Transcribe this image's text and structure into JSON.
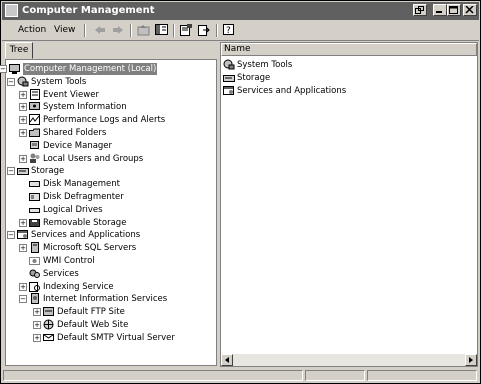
{
  "window": {
    "title": "Computer Management",
    "minimize_icon": "minimize-icon",
    "maximize_icon": "maximize-icon",
    "close_icon": "close-icon",
    "restore_icon": "restore-icon"
  },
  "menu": {
    "action": "Action",
    "view": "View"
  },
  "toolbar": {
    "buttons": [
      "back-icon",
      "forward-icon",
      "up-level-icon",
      "show-hide-tree-icon",
      "properties-icon",
      "export-list-icon",
      "help-icon"
    ]
  },
  "left_pane": {
    "tab_label": "Tree",
    "tree": [
      {
        "label": "Computer Management (Local)",
        "level": 0,
        "icon": "computer-management-icon",
        "expander": "minus",
        "selected": true
      },
      {
        "label": "System Tools",
        "level": 1,
        "icon": "system-tools-icon",
        "expander": "minus"
      },
      {
        "label": "Event Viewer",
        "level": 2,
        "icon": "event-viewer-icon",
        "expander": "plus"
      },
      {
        "label": "System Information",
        "level": 2,
        "icon": "system-information-icon",
        "expander": "plus"
      },
      {
        "label": "Performance Logs and Alerts",
        "level": 2,
        "icon": "performance-logs-icon",
        "expander": "plus"
      },
      {
        "label": "Shared Folders",
        "level": 2,
        "icon": "shared-folders-icon",
        "expander": "plus"
      },
      {
        "label": "Device Manager",
        "level": 2,
        "icon": "device-manager-icon",
        "expander": "none"
      },
      {
        "label": "Local Users and Groups",
        "level": 2,
        "icon": "local-users-icon",
        "expander": "plus"
      },
      {
        "label": "Storage",
        "level": 1,
        "icon": "storage-icon",
        "expander": "minus"
      },
      {
        "label": "Disk Management",
        "level": 2,
        "icon": "disk-management-icon",
        "expander": "none"
      },
      {
        "label": "Disk Defragmenter",
        "level": 2,
        "icon": "disk-defragmenter-icon",
        "expander": "none"
      },
      {
        "label": "Logical Drives",
        "level": 2,
        "icon": "logical-drives-icon",
        "expander": "none"
      },
      {
        "label": "Removable Storage",
        "level": 2,
        "icon": "removable-storage-icon",
        "expander": "plus"
      },
      {
        "label": "Services and Applications",
        "level": 1,
        "icon": "services-applications-icon",
        "expander": "minus"
      },
      {
        "label": "Microsoft SQL Servers",
        "level": 2,
        "icon": "sql-servers-icon",
        "expander": "plus"
      },
      {
        "label": "WMI Control",
        "level": 2,
        "icon": "wmi-control-icon",
        "expander": "none"
      },
      {
        "label": "Services",
        "level": 2,
        "icon": "services-icon",
        "expander": "none"
      },
      {
        "label": "Indexing Service",
        "level": 2,
        "icon": "indexing-service-icon",
        "expander": "plus"
      },
      {
        "label": "Internet Information Services",
        "level": 2,
        "icon": "iis-icon",
        "expander": "minus"
      },
      {
        "label": "Default FTP Site",
        "level": 3,
        "icon": "ftp-site-icon",
        "expander": "plus"
      },
      {
        "label": "Default Web Site",
        "level": 3,
        "icon": "web-site-icon",
        "expander": "plus"
      },
      {
        "label": "Default SMTP Virtual Server",
        "level": 3,
        "icon": "smtp-server-icon",
        "expander": "plus"
      }
    ]
  },
  "right_pane": {
    "column_header": "Name",
    "items": [
      {
        "label": "System Tools",
        "icon": "system-tools-icon"
      },
      {
        "label": "Storage",
        "icon": "storage-icon"
      },
      {
        "label": "Services and Applications",
        "icon": "services-applications-icon"
      }
    ]
  },
  "colors": {
    "titlebar": "#606060",
    "face": "#d4d0c8",
    "selection": "#808080"
  }
}
